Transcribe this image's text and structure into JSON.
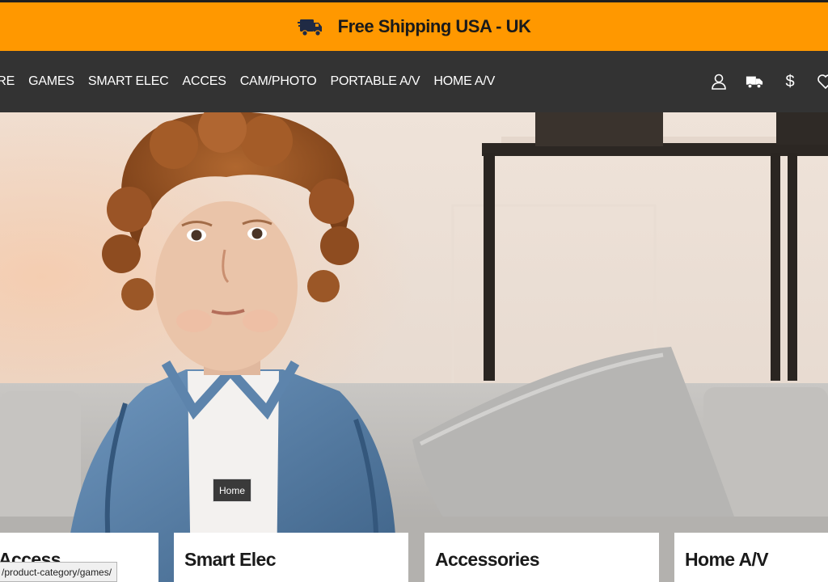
{
  "promo": {
    "text": "Free Shipping USA - UK",
    "icon": "delivery-truck-icon"
  },
  "nav": {
    "items": [
      {
        "label": "ORE"
      },
      {
        "label": "GAMES"
      },
      {
        "label": "SMART ELEC"
      },
      {
        "label": "ACCES"
      },
      {
        "label": "CAM/PHOTO"
      },
      {
        "label": "PORTABLE A/V"
      },
      {
        "label": "HOME A/V"
      }
    ],
    "icons": [
      "user-icon",
      "shipping-truck-icon",
      "currency-icon",
      "wishlist-heart-icon"
    ],
    "currency_symbol": "$"
  },
  "hero": {
    "tooltip": "Home"
  },
  "categories": [
    {
      "title": "Access"
    },
    {
      "title": "Smart Elec"
    },
    {
      "title": "Accessories"
    },
    {
      "title": "Home A/V"
    }
  ],
  "status_bar": {
    "url": "/product-category/games/"
  },
  "colors": {
    "promo_bg": "#ff9800",
    "nav_bg": "#333333"
  }
}
